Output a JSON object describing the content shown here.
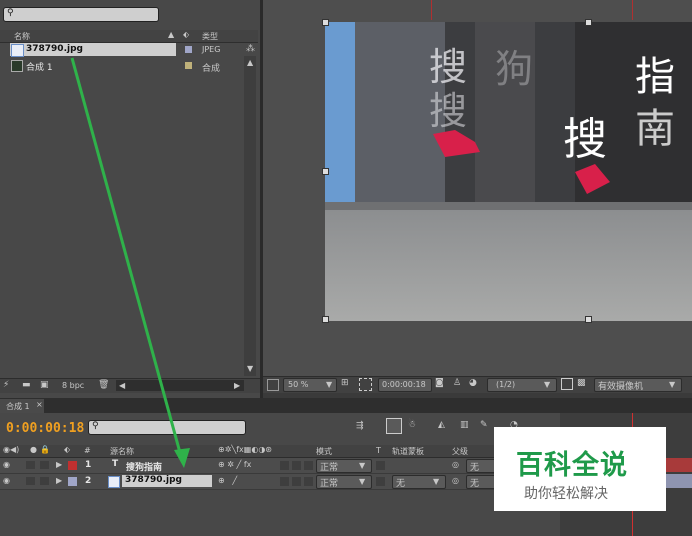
{
  "project": {
    "search_placeholder": "",
    "col_name": "名称",
    "col_type": "类型",
    "items": [
      {
        "name": "378790.jpg",
        "type": "JPEG",
        "label_color": "#a0a6c8"
      },
      {
        "name": "合成 1",
        "type": "合成",
        "label_color": "#bfb17a"
      }
    ],
    "bpc": "8 bpc"
  },
  "viewer": {
    "zoom": "50 %",
    "timecode": "0:00:00:18",
    "resolution": "(1/2)",
    "camera": "有效摄像机"
  },
  "timeline": {
    "tab_label": "合成 1",
    "current_time": "0:00:00:18",
    "search_value": "",
    "headers": {
      "source_name": "源名称",
      "mode": "模式",
      "track_matte": "轨道蒙板",
      "parent": "父级",
      "num": "#",
      "t": "T"
    },
    "layers": [
      {
        "index": "1",
        "name": "搜狗指南",
        "type": "T",
        "mode": "正常",
        "matte": "",
        "parent": "无",
        "label_color": "#c03030"
      },
      {
        "index": "2",
        "name": "378790.jpg",
        "type": "img",
        "mode": "正常",
        "matte": "无",
        "parent": "无",
        "label_color": "#a0a6c8"
      }
    ]
  },
  "watermark": {
    "title": "百科全说",
    "subtitle": "助你轻松解决"
  }
}
